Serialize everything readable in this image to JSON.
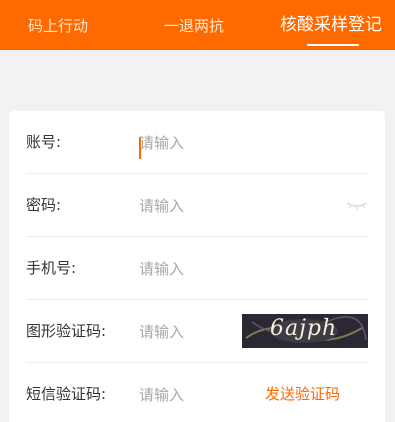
{
  "tabs": [
    {
      "label": "码上行动",
      "active": false
    },
    {
      "label": "一退两抗",
      "active": false
    },
    {
      "label": "核酸采样登记",
      "active": true
    }
  ],
  "colors": {
    "accent": "#ff6a00",
    "background": "#f2f2f2",
    "card": "#ffffff"
  },
  "form": {
    "account": {
      "label": "账号:",
      "placeholder": "请输入",
      "value": ""
    },
    "password": {
      "label": "密码:",
      "placeholder": "请输入",
      "value": "",
      "toggle_icon": "eye-closed-icon"
    },
    "phone": {
      "label": "手机号:",
      "placeholder": "请输入",
      "value": ""
    },
    "captcha": {
      "label": "图形验证码:",
      "placeholder": "请输入",
      "value": "",
      "image_text": "6ajph"
    },
    "sms": {
      "label": "短信验证码:",
      "placeholder": "请输入",
      "value": "",
      "send_label": "发送验证码"
    }
  }
}
